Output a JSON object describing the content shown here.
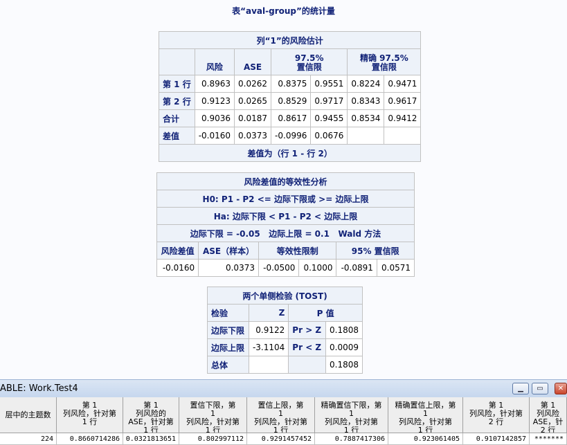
{
  "caption": "表“aval-group”的统计量",
  "risk_table": {
    "title": "列“1”的风险估计",
    "headers": [
      "风险",
      "ASE",
      "97.5%",
      "置信限",
      "精确 97.5%",
      "置信限"
    ],
    "rows": [
      {
        "label": "第 1 行",
        "values": [
          "0.8963",
          "0.0262",
          "0.8375",
          "0.9551",
          "0.8224",
          "0.9471"
        ]
      },
      {
        "label": "第 2 行",
        "values": [
          "0.9123",
          "0.0265",
          "0.8529",
          "0.9717",
          "0.8343",
          "0.9617"
        ]
      },
      {
        "label": "合计",
        "values": [
          "0.9036",
          "0.0187",
          "0.8617",
          "0.9455",
          "0.8534",
          "0.9412"
        ]
      },
      {
        "label": "差值",
        "values": [
          "-0.0160",
          "0.0373",
          "-0.0996",
          "0.0676",
          "",
          ""
        ]
      }
    ],
    "footer": "差值为（行 1 - 行 2）"
  },
  "equiv_table": {
    "title": "风险差值的等效性分析",
    "h0": "H0: P1 - P2 <= 边际下限或 >= 边际上限",
    "ha": "Ha: 边际下限 < P1 - P2 < 边际上限",
    "margins": "边际下限 = -0.05   边际上限 = 0.1   Wald 方法",
    "headers": [
      "风险差值",
      "ASE（样本）",
      "等效性限制",
      "95% 置信限"
    ],
    "values": [
      "-0.0160",
      "0.0373",
      "-0.0500",
      "0.1000",
      "-0.0891",
      "0.0571"
    ]
  },
  "tost_table": {
    "title": "两个单侧检验 (TOST)",
    "headers": [
      "检验",
      "Z",
      "P 值"
    ],
    "rows": [
      {
        "label": "边际下限",
        "z": "0.9122",
        "test": "Pr > Z",
        "p": "0.1808"
      },
      {
        "label": "边际上限",
        "z": "-3.1104",
        "test": "Pr < Z",
        "p": "0.0009"
      },
      {
        "label": "总体",
        "z": "",
        "test": "",
        "p": "0.1808"
      }
    ]
  },
  "viewtable": {
    "title": "ABLE: Work.Test4",
    "buttons": {
      "minimize": "▁",
      "restore": "▭",
      "close": "✕"
    },
    "columns": [
      {
        "l1": "层中的主题数",
        "l2": "",
        "l3": "",
        "l4": ""
      },
      {
        "l1": "第 1",
        "l2": "列风险，针对第",
        "l3": "1 行",
        "l4": ""
      },
      {
        "l1": "第 1",
        "l2": "列风险的",
        "l3": "ASE，针对第",
        "l4": "1 行"
      },
      {
        "l1": "置信下限，第",
        "l2": "1",
        "l3": "列风险，针对第",
        "l4": "1 行"
      },
      {
        "l1": "置信上限，第",
        "l2": "1",
        "l3": "列风险，针对第",
        "l4": "1 行"
      },
      {
        "l1": "精确置信下限，第",
        "l2": "1",
        "l3": "列风险，针对第",
        "l4": "1 行"
      },
      {
        "l1": "精确置信上限，第",
        "l2": "1",
        "l3": "列风险，针对第",
        "l4": "1 行"
      },
      {
        "l1": "第 1",
        "l2": "列风险，针对第",
        "l3": "2 行",
        "l4": ""
      },
      {
        "l1": "第 1",
        "l2": "列风险",
        "l3": "ASE，针",
        "l4": "2 行"
      }
    ],
    "row": [
      "224",
      "0.8660714286",
      "0.0321813651",
      "0.802997112",
      "0.9291457452",
      "0.7887417306",
      "0.923061405",
      "0.9107142857",
      "*******"
    ]
  }
}
